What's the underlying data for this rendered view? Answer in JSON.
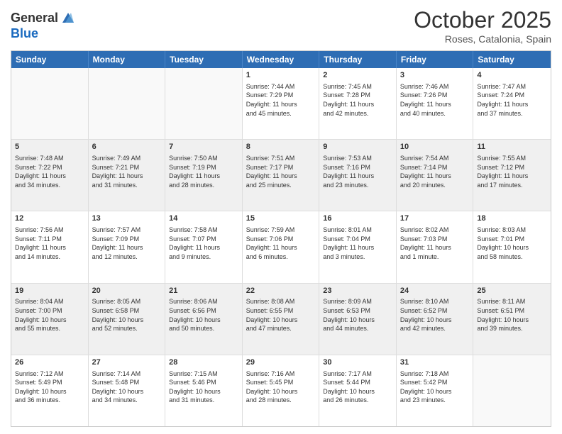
{
  "header": {
    "logo_line1": "General",
    "logo_line2": "Blue",
    "month": "October 2025",
    "location": "Roses, Catalonia, Spain"
  },
  "weekdays": [
    "Sunday",
    "Monday",
    "Tuesday",
    "Wednesday",
    "Thursday",
    "Friday",
    "Saturday"
  ],
  "rows": [
    [
      {
        "day": "",
        "text": ""
      },
      {
        "day": "",
        "text": ""
      },
      {
        "day": "",
        "text": ""
      },
      {
        "day": "1",
        "text": "Sunrise: 7:44 AM\nSunset: 7:29 PM\nDaylight: 11 hours\nand 45 minutes."
      },
      {
        "day": "2",
        "text": "Sunrise: 7:45 AM\nSunset: 7:28 PM\nDaylight: 11 hours\nand 42 minutes."
      },
      {
        "day": "3",
        "text": "Sunrise: 7:46 AM\nSunset: 7:26 PM\nDaylight: 11 hours\nand 40 minutes."
      },
      {
        "day": "4",
        "text": "Sunrise: 7:47 AM\nSunset: 7:24 PM\nDaylight: 11 hours\nand 37 minutes."
      }
    ],
    [
      {
        "day": "5",
        "text": "Sunrise: 7:48 AM\nSunset: 7:22 PM\nDaylight: 11 hours\nand 34 minutes."
      },
      {
        "day": "6",
        "text": "Sunrise: 7:49 AM\nSunset: 7:21 PM\nDaylight: 11 hours\nand 31 minutes."
      },
      {
        "day": "7",
        "text": "Sunrise: 7:50 AM\nSunset: 7:19 PM\nDaylight: 11 hours\nand 28 minutes."
      },
      {
        "day": "8",
        "text": "Sunrise: 7:51 AM\nSunset: 7:17 PM\nDaylight: 11 hours\nand 25 minutes."
      },
      {
        "day": "9",
        "text": "Sunrise: 7:53 AM\nSunset: 7:16 PM\nDaylight: 11 hours\nand 23 minutes."
      },
      {
        "day": "10",
        "text": "Sunrise: 7:54 AM\nSunset: 7:14 PM\nDaylight: 11 hours\nand 20 minutes."
      },
      {
        "day": "11",
        "text": "Sunrise: 7:55 AM\nSunset: 7:12 PM\nDaylight: 11 hours\nand 17 minutes."
      }
    ],
    [
      {
        "day": "12",
        "text": "Sunrise: 7:56 AM\nSunset: 7:11 PM\nDaylight: 11 hours\nand 14 minutes."
      },
      {
        "day": "13",
        "text": "Sunrise: 7:57 AM\nSunset: 7:09 PM\nDaylight: 11 hours\nand 12 minutes."
      },
      {
        "day": "14",
        "text": "Sunrise: 7:58 AM\nSunset: 7:07 PM\nDaylight: 11 hours\nand 9 minutes."
      },
      {
        "day": "15",
        "text": "Sunrise: 7:59 AM\nSunset: 7:06 PM\nDaylight: 11 hours\nand 6 minutes."
      },
      {
        "day": "16",
        "text": "Sunrise: 8:01 AM\nSunset: 7:04 PM\nDaylight: 11 hours\nand 3 minutes."
      },
      {
        "day": "17",
        "text": "Sunrise: 8:02 AM\nSunset: 7:03 PM\nDaylight: 11 hours\nand 1 minute."
      },
      {
        "day": "18",
        "text": "Sunrise: 8:03 AM\nSunset: 7:01 PM\nDaylight: 10 hours\nand 58 minutes."
      }
    ],
    [
      {
        "day": "19",
        "text": "Sunrise: 8:04 AM\nSunset: 7:00 PM\nDaylight: 10 hours\nand 55 minutes."
      },
      {
        "day": "20",
        "text": "Sunrise: 8:05 AM\nSunset: 6:58 PM\nDaylight: 10 hours\nand 52 minutes."
      },
      {
        "day": "21",
        "text": "Sunrise: 8:06 AM\nSunset: 6:56 PM\nDaylight: 10 hours\nand 50 minutes."
      },
      {
        "day": "22",
        "text": "Sunrise: 8:08 AM\nSunset: 6:55 PM\nDaylight: 10 hours\nand 47 minutes."
      },
      {
        "day": "23",
        "text": "Sunrise: 8:09 AM\nSunset: 6:53 PM\nDaylight: 10 hours\nand 44 minutes."
      },
      {
        "day": "24",
        "text": "Sunrise: 8:10 AM\nSunset: 6:52 PM\nDaylight: 10 hours\nand 42 minutes."
      },
      {
        "day": "25",
        "text": "Sunrise: 8:11 AM\nSunset: 6:51 PM\nDaylight: 10 hours\nand 39 minutes."
      }
    ],
    [
      {
        "day": "26",
        "text": "Sunrise: 7:12 AM\nSunset: 5:49 PM\nDaylight: 10 hours\nand 36 minutes."
      },
      {
        "day": "27",
        "text": "Sunrise: 7:14 AM\nSunset: 5:48 PM\nDaylight: 10 hours\nand 34 minutes."
      },
      {
        "day": "28",
        "text": "Sunrise: 7:15 AM\nSunset: 5:46 PM\nDaylight: 10 hours\nand 31 minutes."
      },
      {
        "day": "29",
        "text": "Sunrise: 7:16 AM\nSunset: 5:45 PM\nDaylight: 10 hours\nand 28 minutes."
      },
      {
        "day": "30",
        "text": "Sunrise: 7:17 AM\nSunset: 5:44 PM\nDaylight: 10 hours\nand 26 minutes."
      },
      {
        "day": "31",
        "text": "Sunrise: 7:18 AM\nSunset: 5:42 PM\nDaylight: 10 hours\nand 23 minutes."
      },
      {
        "day": "",
        "text": ""
      }
    ]
  ]
}
